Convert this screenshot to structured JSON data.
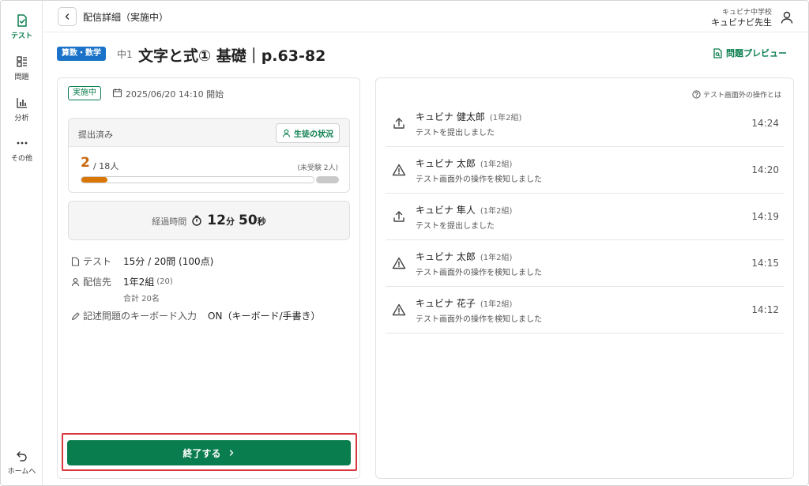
{
  "sidebar": {
    "items": [
      {
        "label": "テスト",
        "icon": "test-icon",
        "active": true
      },
      {
        "label": "問題",
        "icon": "problems-icon"
      },
      {
        "label": "分析",
        "icon": "analytics-icon"
      },
      {
        "label": "その他",
        "icon": "more-icon"
      }
    ],
    "home_label": "ホームへ"
  },
  "header": {
    "title": "配信詳細（実施中）",
    "school": "キュビナ中学校",
    "teacher": "キュビナビ先生"
  },
  "title_row": {
    "subject": "算数・数学",
    "grade": "中1",
    "title": "文字と式① 基礎｜p.63-82",
    "preview_label": "問題プレビュー"
  },
  "summary": {
    "status": "実施中",
    "start": "2025/06/20 14:10 開始",
    "submitted_label": "提出済み",
    "student_status_label": "生徒の状況",
    "submitted_count": "2",
    "total_text": "/ 18人",
    "untaken_text": "(未受験 2人)",
    "progress_fraction": 0.111,
    "elapsed_label": "経過時間",
    "elapsed_min": "12",
    "elapsed_min_unit": "分",
    "elapsed_sec": "50",
    "elapsed_sec_unit": "秒",
    "test_label": "テスト",
    "test_value": "15分 / 20問 (100点)",
    "dest_label": "配信先",
    "dest_value": "1年2組",
    "dest_count": "(20)",
    "dest_total": "合計 20名",
    "keyboard_label": "記述問題のキーボード入力",
    "keyboard_value": "ON（キーボード/手書き）",
    "end_label": "終了する"
  },
  "activity": {
    "help_label": "テスト画面外の操作とは",
    "events": [
      {
        "name": "キュビナ 健太郎",
        "class": "(1年2組)",
        "desc": "テストを提出しました",
        "time": "14:24",
        "icon": "upload-icon"
      },
      {
        "name": "キュビナ 太郎",
        "class": "(1年2組)",
        "desc": "テスト画面外の操作を検知しました",
        "time": "14:20",
        "icon": "warning-icon"
      },
      {
        "name": "キュビナ 隼人",
        "class": "(1年2組)",
        "desc": "テストを提出しました",
        "time": "14:19",
        "icon": "upload-icon"
      },
      {
        "name": "キュビナ 太郎",
        "class": "(1年2組)",
        "desc": "テスト画面外の操作を検知しました",
        "time": "14:15",
        "icon": "warning-icon"
      },
      {
        "name": "キュビナ 花子",
        "class": "(1年2組)",
        "desc": "テスト画面外の操作を検知しました",
        "time": "14:12",
        "icon": "warning-icon"
      }
    ]
  },
  "colors": {
    "accent": "#0a7d4e",
    "subject": "#1a73c8",
    "progress": "#d97706",
    "highlight": "#d9363e"
  }
}
